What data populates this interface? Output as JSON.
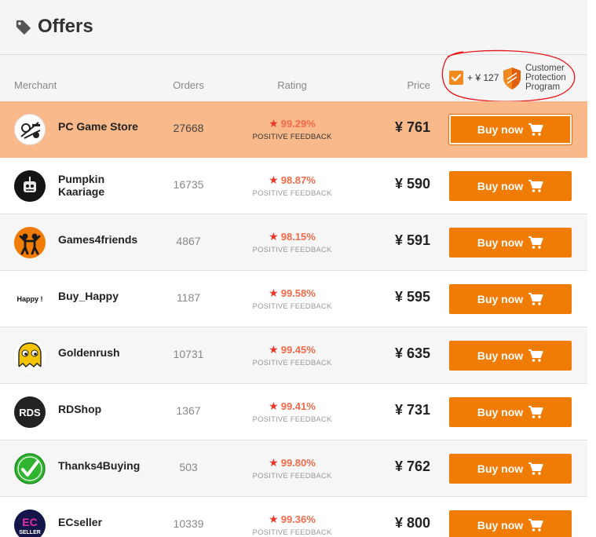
{
  "header": {
    "title": "Offers"
  },
  "columns": {
    "merchant": "Merchant",
    "orders": "Orders",
    "rating": "Rating",
    "price": "Price"
  },
  "protection": {
    "amount": "+ ¥ 127",
    "label": "Customer Protection Program",
    "checked": true
  },
  "colors": {
    "accent": "#f07b05",
    "highlight_row": "#f9b98a",
    "rating_text": "#f06a4a",
    "star": "#e8392a"
  },
  "offers": [
    {
      "merchant": "PC Game Store",
      "orders": "27668",
      "rating": "99.29%",
      "feedback": "POSITIVE FEEDBACK",
      "price": "¥ 761",
      "buy_label": "Buy now",
      "avatar_icon": "steam-logo-icon"
    },
    {
      "merchant": "Pumpkin Kaariage",
      "orders": "16735",
      "rating": "98.87%",
      "feedback": "POSITIVE FEEDBACK",
      "price": "¥ 590",
      "buy_label": "Buy now",
      "avatar_icon": "pumpkin-icon"
    },
    {
      "merchant": "Games4friends",
      "orders": "4867",
      "rating": "98.15%",
      "feedback": "POSITIVE FEEDBACK",
      "price": "¥ 591",
      "buy_label": "Buy now",
      "avatar_icon": "friends-icon"
    },
    {
      "merchant": "Buy_Happy",
      "orders": "1187",
      "rating": "99.58%",
      "feedback": "POSITIVE FEEDBACK",
      "price": "¥ 595",
      "buy_label": "Buy now",
      "avatar_icon": "happy-logo-icon",
      "avatar_text": "Happy !"
    },
    {
      "merchant": "Goldenrush",
      "orders": "10731",
      "rating": "99.45%",
      "feedback": "POSITIVE FEEDBACK",
      "price": "¥ 635",
      "buy_label": "Buy now",
      "avatar_icon": "ghost-icon"
    },
    {
      "merchant": "RDShop",
      "orders": "1367",
      "rating": "99.41%",
      "feedback": "POSITIVE FEEDBACK",
      "price": "¥ 731",
      "buy_label": "Buy now",
      "avatar_icon": "rds-logo-icon",
      "avatar_text": "RDS"
    },
    {
      "merchant": "Thanks4Buying",
      "orders": "503",
      "rating": "99.80%",
      "feedback": "POSITIVE FEEDBACK",
      "price": "¥ 762",
      "buy_label": "Buy now",
      "avatar_icon": "checkmark-icon"
    },
    {
      "merchant": "ECseller",
      "orders": "10339",
      "rating": "99.36%",
      "feedback": "POSITIVE FEEDBACK",
      "price": "¥ 800",
      "buy_label": "Buy now",
      "avatar_icon": "ec-seller-logo-icon",
      "avatar_text": [
        "EC",
        "SELLER"
      ]
    }
  ]
}
